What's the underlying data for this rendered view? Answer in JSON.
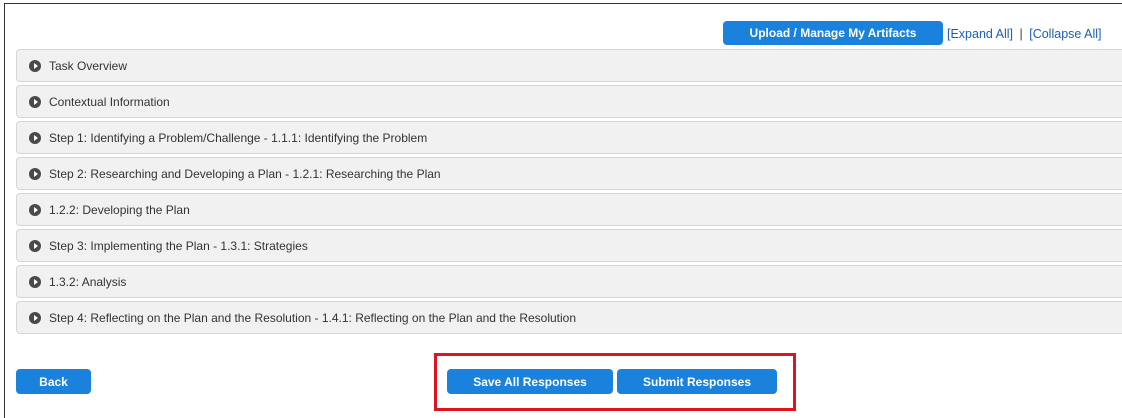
{
  "toolbar": {
    "upload_label": "Upload / Manage My Artifacts",
    "expand_all": "[Expand All]",
    "separator": "|",
    "collapse_all": "[Collapse All]"
  },
  "panels": [
    {
      "label": "Task Overview",
      "icon": "expand-arrow-icon"
    },
    {
      "label": "Contextual Information",
      "icon": "expand-arrow-icon"
    },
    {
      "label": "Step 1: Identifying a Problem/Challenge - 1.1.1: Identifying the Problem",
      "icon": "expand-arrow-icon"
    },
    {
      "label": "Step 2: Researching and Developing a Plan - 1.2.1: Researching the Plan",
      "icon": "expand-arrow-icon"
    },
    {
      "label": "1.2.2: Developing the Plan",
      "icon": "expand-arrow-icon"
    },
    {
      "label": "Step 3: Implementing the Plan - 1.3.1: Strategies",
      "icon": "expand-arrow-icon"
    },
    {
      "label": "1.3.2: Analysis",
      "icon": "expand-arrow-icon"
    },
    {
      "label": "Step 4: Reflecting on the Plan and the Resolution - 1.4.1: Reflecting on the Plan and the Resolution",
      "icon": "expand-arrow-icon"
    }
  ],
  "footer": {
    "back_label": "Back",
    "save_label": "Save All Responses",
    "submit_label": "Submit Responses"
  },
  "colors": {
    "button": "#1a82dc",
    "highlight": "#e0141e",
    "panel_bg": "#f1f1f1"
  }
}
